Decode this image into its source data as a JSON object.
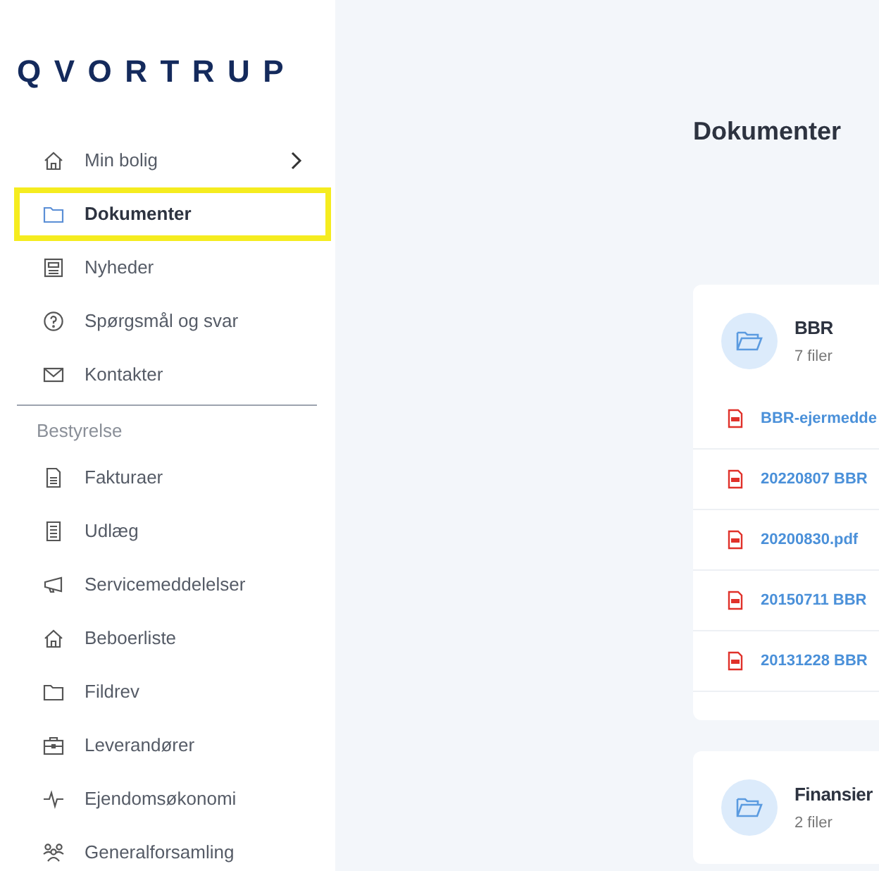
{
  "logo": "QVORTRUP",
  "nav": [
    {
      "label": "Min bolig",
      "selected": false,
      "submenu": true
    },
    {
      "label": "Dokumenter",
      "selected": true,
      "submenu": false
    },
    {
      "label": "Nyheder",
      "selected": false,
      "submenu": false
    },
    {
      "label": "Spørgsmål og svar",
      "selected": false,
      "submenu": false
    },
    {
      "label": "Kontakter",
      "selected": false,
      "submenu": false
    }
  ],
  "section_heading": "Bestyrelse",
  "board_nav": [
    {
      "label": "Fakturaer",
      "selected": false
    },
    {
      "label": "Udlæg",
      "selected": false
    },
    {
      "label": "Servicemeddelelser",
      "selected": false
    },
    {
      "label": "Beboerliste",
      "selected": false
    },
    {
      "label": "Fildrev",
      "selected": false
    },
    {
      "label": "Leverandører",
      "selected": false
    },
    {
      "label": "Ejendomsøkonomi",
      "selected": false
    },
    {
      "label": "Generalforsamling",
      "selected": false
    }
  ],
  "page_title": "Dokumenter",
  "folders": [
    {
      "name": "BBR",
      "count": "7 filer",
      "files": [
        "BBR-ejermedde",
        "20220807 BBR",
        "20200830.pdf",
        "20150711 BBR",
        "20131228 BBR"
      ]
    },
    {
      "name": "Finansier",
      "count": "2 filer"
    }
  ]
}
